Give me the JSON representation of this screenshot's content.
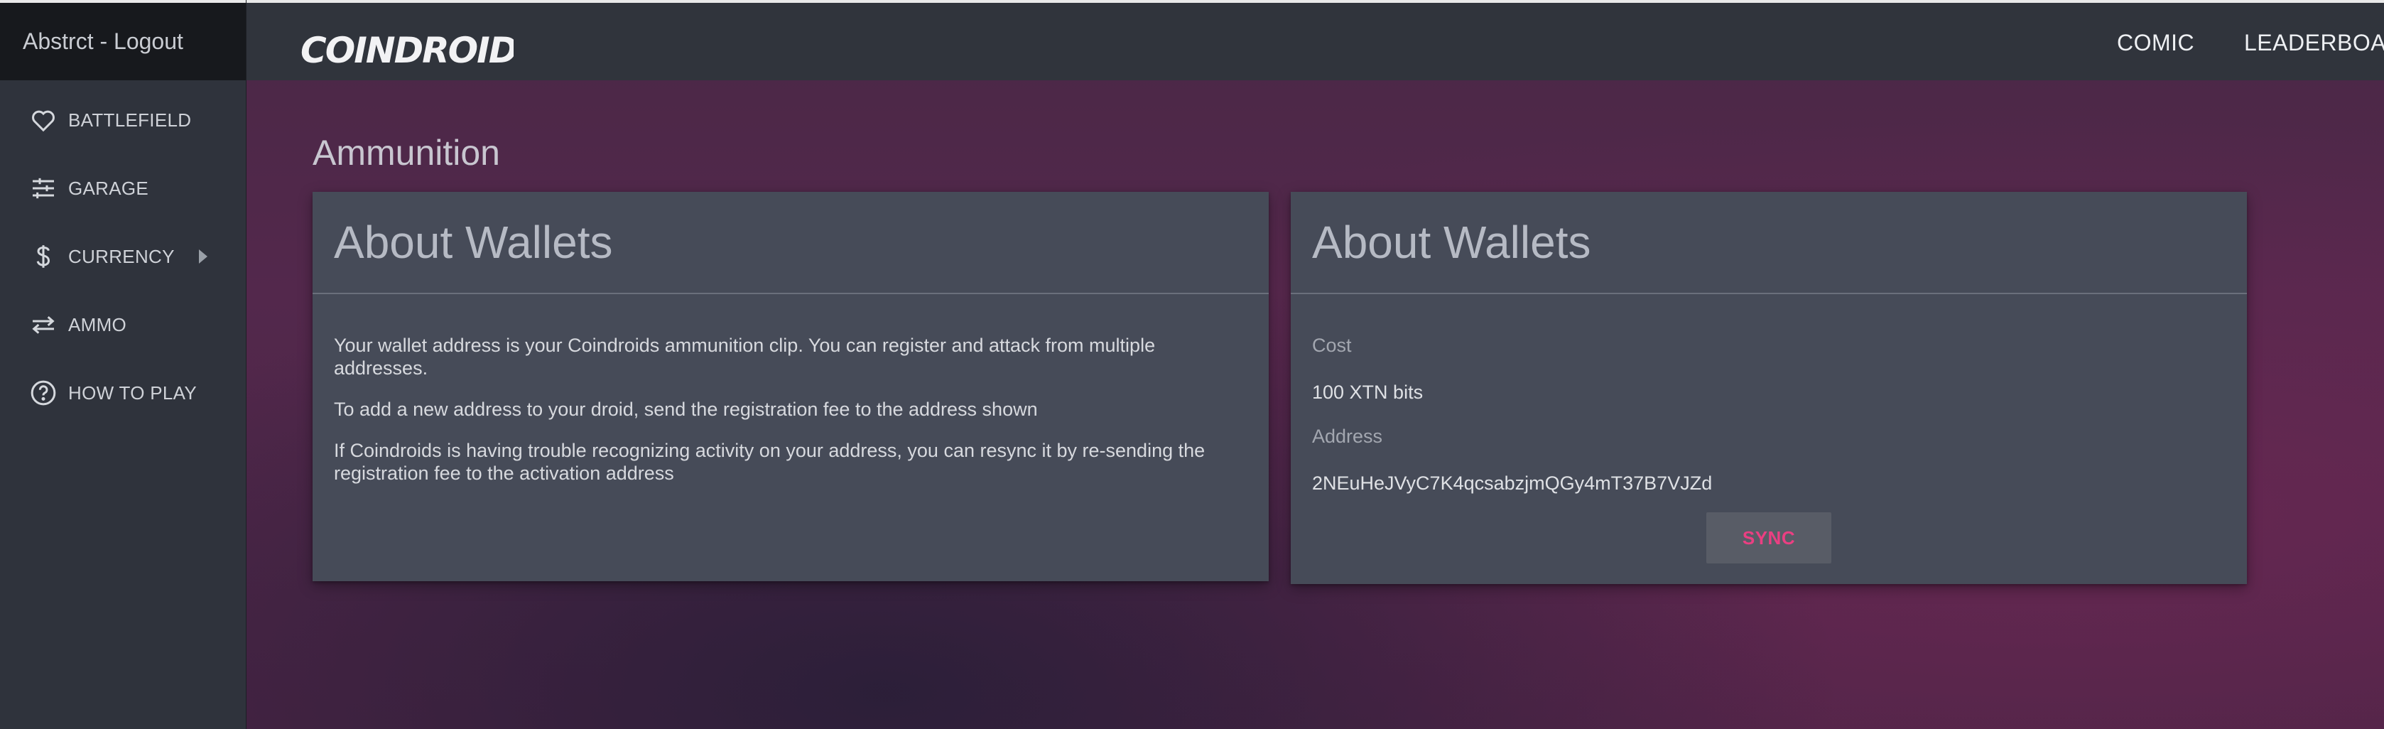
{
  "sidebar": {
    "header": "Abstrct - Logout",
    "items": [
      {
        "label": "BATTLEFIELD",
        "icon": "heart-icon"
      },
      {
        "label": "GARAGE",
        "icon": "sliders-icon"
      },
      {
        "label": "CURRENCY",
        "icon": "dollar-icon"
      },
      {
        "label": "AMMO",
        "icon": "swap-arrows-icon"
      },
      {
        "label": "HOW TO PLAY",
        "icon": "help-circle-icon"
      }
    ]
  },
  "header": {
    "logo_text": "COINDROIDS",
    "links": [
      {
        "label": "COMIC"
      },
      {
        "label": "LEADERBOAR"
      }
    ]
  },
  "main": {
    "page_title": "Ammunition",
    "info_card": {
      "title": "About Wallets",
      "paragraphs": [
        "Your wallet address is your Coindroids ammunition clip. You can register and attack from multiple addresses.",
        "To add a new address to your droid, send the registration fee to the address shown",
        "If Coindroids is having trouble recognizing activity on your address, you can resync it by re-sending the registration fee to the activation address"
      ]
    },
    "details_card": {
      "title": "About Wallets",
      "cost_label": "Cost",
      "cost_value": "100 XTN bits",
      "address_label": "Address",
      "address_value": "2NEuHeJVyC7K4qcsabzjmQGy4mT37B7VJZd",
      "sync_label": "SYNC"
    }
  },
  "colors": {
    "accent": "#ea3f82",
    "sidebar_bg": "#2f333c",
    "card_bg": "#464b58",
    "background": "#4f2749"
  }
}
